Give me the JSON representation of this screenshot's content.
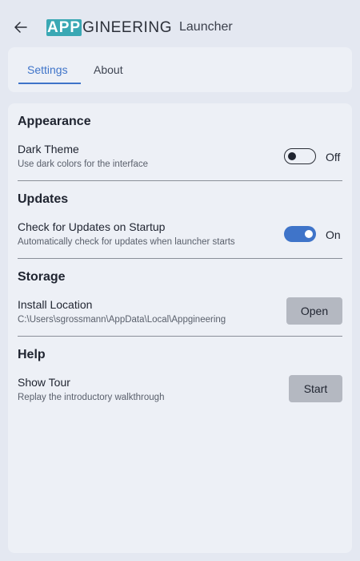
{
  "titlebar": {
    "logo_highlight": "APP",
    "logo_rest": "GINEERING",
    "app_name": "Launcher"
  },
  "tabs": [
    {
      "label": "Settings",
      "active": true
    },
    {
      "label": "About",
      "active": false
    }
  ],
  "sections": {
    "appearance": {
      "title": "Appearance",
      "dark_theme": {
        "label": "Dark Theme",
        "description": "Use dark colors for the interface",
        "state": "Off"
      }
    },
    "updates": {
      "title": "Updates",
      "check_updates": {
        "label": "Check for Updates on Startup",
        "description": "Automatically check for updates when launcher starts",
        "state": "On"
      }
    },
    "storage": {
      "title": "Storage",
      "install_location": {
        "label": "Install Location",
        "description": "C:\\Users\\sgrossmann\\AppData\\Local\\Appgineering",
        "button": "Open"
      }
    },
    "help": {
      "title": "Help",
      "show_tour": {
        "label": "Show Tour",
        "description": "Replay the introductory walkthrough",
        "button": "Start"
      }
    }
  },
  "colors": {
    "accent": "#3f74c9",
    "logo": "#3aa8b4"
  },
  "icons": {
    "back": "back-arrow-icon"
  }
}
